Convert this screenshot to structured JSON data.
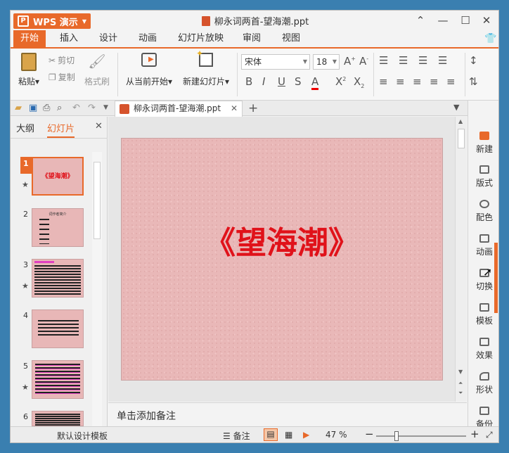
{
  "app": {
    "name": "WPS 演示",
    "doc_title": "柳永词两首-望海潮.ppt"
  },
  "menu": [
    "开始",
    "插入",
    "设计",
    "动画",
    "幻灯片放映",
    "审阅",
    "视图"
  ],
  "ribbon": {
    "paste": "粘贴",
    "cut": "剪切",
    "copy": "复制",
    "format_painter": "格式刷",
    "from_current": "从当前开始",
    "new_slide": "新建幻灯片",
    "font_name": "宋体",
    "font_size": "18"
  },
  "doc_tab": "柳永词两首-望海潮.ppt",
  "left_panel": {
    "tab_outline": "大纲",
    "tab_slides": "幻灯片",
    "slide_numbers": [
      "1",
      "2",
      "3",
      "4",
      "5",
      "6"
    ],
    "thumb1_text": "《望海潮》",
    "thumb2_text": "词作者简介"
  },
  "slide": {
    "title": "《望海潮》"
  },
  "notes_placeholder": "单击添加备注",
  "task_pane": [
    "新建",
    "版式",
    "配色",
    "动画",
    "切换",
    "模板",
    "效果",
    "形状",
    "备份"
  ],
  "status": {
    "template": "默认设计模板",
    "notes": "备注",
    "zoom": "47 %"
  },
  "zoom_level": 0.47,
  "colors": {
    "accent": "#e8692a",
    "slide_bg": "#e9b8b8",
    "title": "#e0121a"
  }
}
